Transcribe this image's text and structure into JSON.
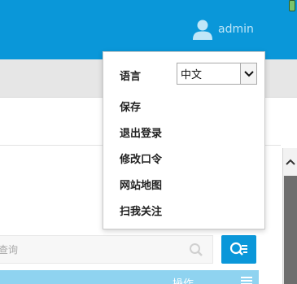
{
  "header": {
    "username": "admin",
    "accent_color": "#0a97d9",
    "user_icon": "user-icon"
  },
  "dropdown": {
    "language_label": "语言",
    "language_value": "中文",
    "items": [
      "保存",
      "退出登录",
      "修改口令",
      "网站地图",
      "扫我关注"
    ]
  },
  "search": {
    "placeholder": "查询",
    "button_icon": "search-filter-icon"
  },
  "table": {
    "operations_header": "操作"
  }
}
